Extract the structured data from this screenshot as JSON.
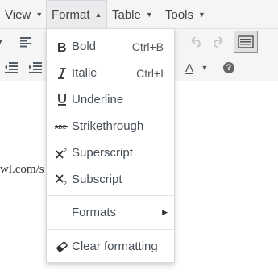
{
  "menubar": {
    "items": [
      {
        "label": "View"
      },
      {
        "label": "Format"
      },
      {
        "label": "Table"
      },
      {
        "label": "Tools"
      }
    ]
  },
  "content": {
    "url_fragment": "wl.com/s"
  },
  "format_menu": {
    "items": [
      {
        "label": "Bold",
        "shortcut": "Ctrl+B",
        "icon": "bold-icon"
      },
      {
        "label": "Italic",
        "shortcut": "Ctrl+I",
        "icon": "italic-icon"
      },
      {
        "label": "Underline",
        "shortcut": "",
        "icon": "underline-icon"
      },
      {
        "label": "Strikethrough",
        "shortcut": "",
        "icon": "strikethrough-icon"
      },
      {
        "label": "Superscript",
        "shortcut": "",
        "icon": "superscript-icon"
      },
      {
        "label": "Subscript",
        "shortcut": "",
        "icon": "subscript-icon"
      }
    ],
    "formats": {
      "label": "Formats"
    },
    "clear": {
      "label": "Clear formatting",
      "icon": "eraser-icon"
    }
  },
  "toolbar": {
    "text_color_letter": "A",
    "help_glyph": "?"
  }
}
